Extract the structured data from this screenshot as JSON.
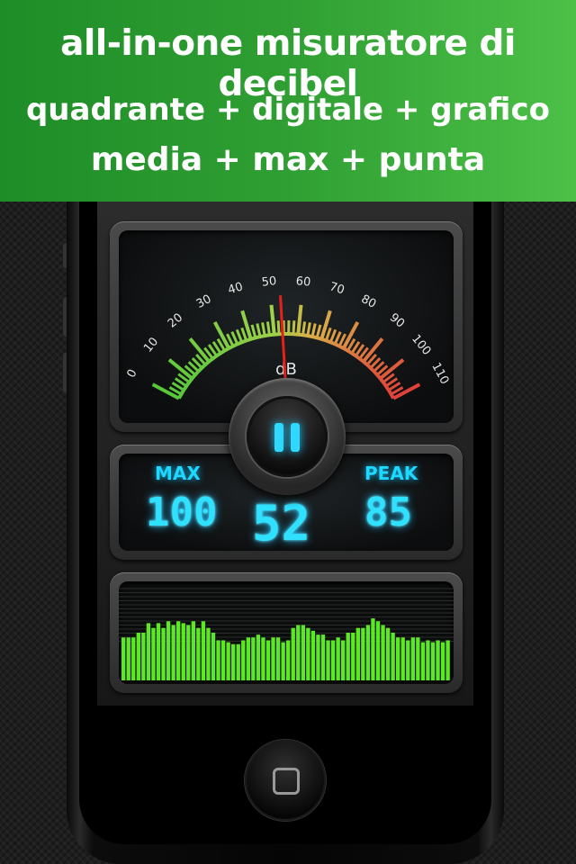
{
  "banner": {
    "line1": "all-in-one misuratore di decibel",
    "line2": "quadrante + digitale + grafico",
    "line3": "media + max + punta"
  },
  "meter": {
    "scale_labels": [
      "0",
      "10",
      "20",
      "30",
      "40",
      "50",
      "60",
      "70",
      "80",
      "90",
      "100",
      "110"
    ],
    "unit": "dB",
    "needle_value": 52
  },
  "readout": {
    "max_label": "MAX",
    "max_value": "100",
    "current_value": "52",
    "peak_label": "PEAK",
    "peak_value": "85"
  },
  "controls": {
    "pause_icon": "pause-icon"
  },
  "graph": {
    "levels": [
      0.45,
      0.45,
      0.45,
      0.5,
      0.5,
      0.6,
      0.55,
      0.6,
      0.55,
      0.62,
      0.58,
      0.62,
      0.6,
      0.58,
      0.62,
      0.55,
      0.62,
      0.55,
      0.5,
      0.42,
      0.42,
      0.4,
      0.38,
      0.38,
      0.42,
      0.45,
      0.45,
      0.48,
      0.45,
      0.42,
      0.45,
      0.45,
      0.4,
      0.42,
      0.55,
      0.58,
      0.58,
      0.55,
      0.52,
      0.48,
      0.48,
      0.42,
      0.42,
      0.45,
      0.42,
      0.5,
      0.5,
      0.55,
      0.55,
      0.58,
      0.65,
      0.62,
      0.58,
      0.55,
      0.5,
      0.45,
      0.45,
      0.42,
      0.45,
      0.45,
      0.4,
      0.42,
      0.4,
      0.42,
      0.4,
      0.42
    ],
    "bar_color": "#5de826"
  },
  "colors": {
    "accent": "#2fe0ff",
    "banner": "#2f9f33"
  }
}
